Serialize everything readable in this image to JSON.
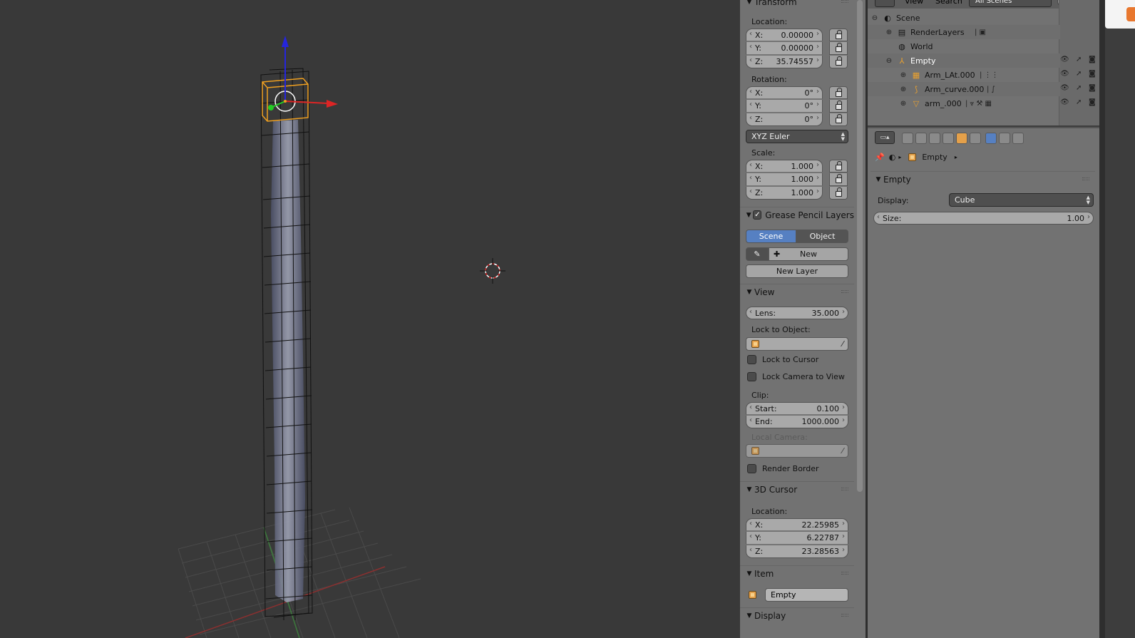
{
  "npanel": {
    "transform": {
      "title": "Transform",
      "location_label": "Location:",
      "location": {
        "x": "X:",
        "x_val": "0.00000",
        "y": "Y:",
        "y_val": "0.00000",
        "z": "Z:",
        "z_val": "35.74557"
      },
      "rotation_label": "Rotation:",
      "rotation": {
        "x": "X:",
        "x_val": "0°",
        "y": "Y:",
        "y_val": "0°",
        "z": "Z:",
        "z_val": "0°"
      },
      "rotation_mode": "XYZ Euler",
      "scale_label": "Scale:",
      "scale": {
        "x": "X:",
        "x_val": "1.000",
        "y": "Y:",
        "y_val": "1.000",
        "z": "Z:",
        "z_val": "1.000"
      }
    },
    "grease_pencil": {
      "title": "Grease Pencil Layers",
      "scene": "Scene",
      "object": "Object",
      "new": "New",
      "new_layer": "New Layer"
    },
    "view": {
      "title": "View",
      "lens_label": "Lens:",
      "lens_val": "35.000",
      "lock_to_object": "Lock to Object:",
      "lock_to_cursor": "Lock to Cursor",
      "lock_camera": "Lock Camera to View",
      "clip_label": "Clip:",
      "start_label": "Start:",
      "start_val": "0.100",
      "end_label": "End:",
      "end_val": "1000.000",
      "local_camera": "Local Camera:",
      "render_border": "Render Border"
    },
    "cursor": {
      "title": "3D Cursor",
      "location_label": "Location:",
      "x": "X:",
      "x_val": "22.25985",
      "y": "Y:",
      "y_val": "6.22787",
      "z": "Z:",
      "z_val": "23.28563"
    },
    "item": {
      "title": "Item",
      "name": "Empty"
    },
    "display": {
      "title": "Display"
    }
  },
  "outliner": {
    "menu_view": "View",
    "menu_search": "Search",
    "scenes_dropdown": "All Scenes",
    "rows": [
      {
        "label": "Scene"
      },
      {
        "label": "RenderLayers"
      },
      {
        "label": "World"
      },
      {
        "label": "Empty"
      },
      {
        "label": "Arm_LAt.000"
      },
      {
        "label": "Arm_curve.000"
      },
      {
        "label": "arm_.000"
      }
    ]
  },
  "properties": {
    "breadcrumb_object": "Empty",
    "panel_title": "Empty",
    "display_label": "Display:",
    "display_value": "Cube",
    "size_label": "Size:",
    "size_value": "1.00"
  },
  "colors": {
    "accent_blue": "#5680c2",
    "viewport_bg": "#393939",
    "panel_bg": "#727272",
    "selection_orange": "#f0a020"
  }
}
